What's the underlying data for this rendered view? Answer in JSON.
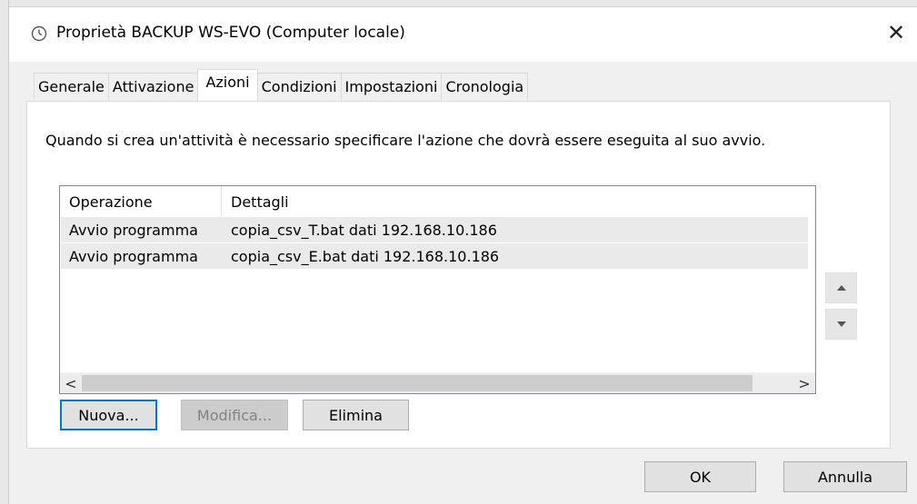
{
  "window": {
    "title": "Proprietà BACKUP WS-EVO (Computer locale)",
    "icon": "clock-icon",
    "close_glyph": "✕"
  },
  "tabs": [
    {
      "label": "Generale",
      "active": false
    },
    {
      "label": "Attivazione",
      "active": false
    },
    {
      "label": "Azioni",
      "active": true
    },
    {
      "label": "Condizioni",
      "active": false
    },
    {
      "label": "Impostazioni",
      "active": false
    },
    {
      "label": "Cronologia",
      "active": false
    }
  ],
  "panel": {
    "description": "Quando si crea un'attività è necessario specificare l'azione che dovrà essere eseguita al suo avvio."
  },
  "actions_table": {
    "columns": [
      "Operazione",
      "Dettagli"
    ],
    "rows": [
      {
        "operazione": "Avvio programma",
        "dettagli": "copia_csv_T.bat dati 192.168.10.186"
      },
      {
        "operazione": "Avvio programma",
        "dettagli": "copia_csv_E.bat dati 192.168.10.186"
      }
    ],
    "scroll_left_glyph": "<",
    "scroll_right_glyph": ">"
  },
  "action_buttons": {
    "new_label": "Nuova...",
    "edit_label": "Modifica...",
    "delete_label": "Elimina"
  },
  "footer": {
    "ok_label": "OK",
    "cancel_label": "Annulla"
  },
  "colors": {
    "accent": "#0078d7",
    "dialog_bg": "#f0f0f0",
    "selected_row": "#eaeaea"
  }
}
